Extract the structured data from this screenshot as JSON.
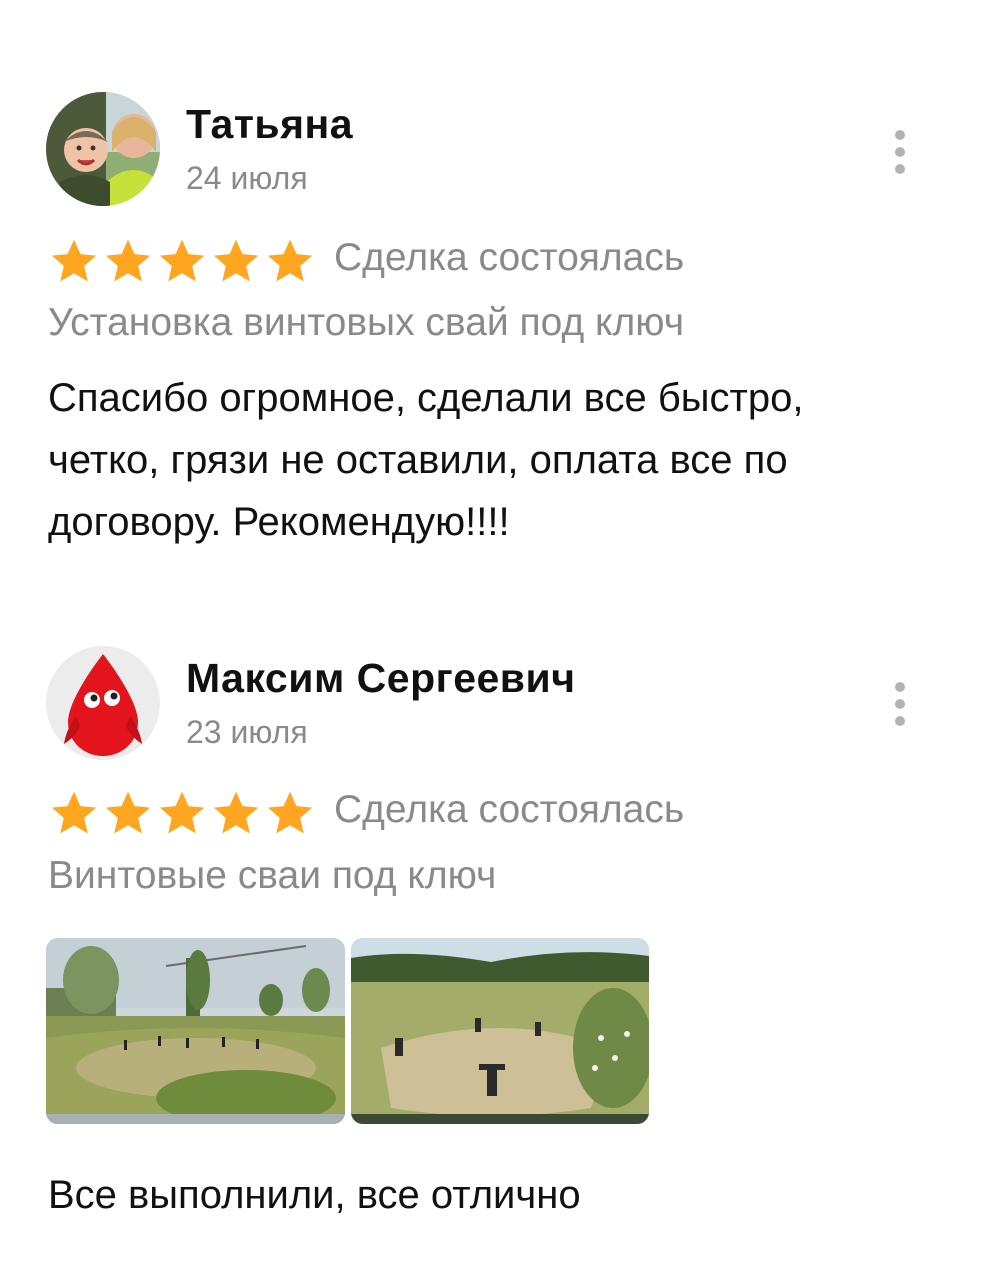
{
  "reviews": [
    {
      "author": "Татьяна",
      "date": "24 июля",
      "rating": 5,
      "status": "Сделка состоялась",
      "service": "Установка винтовых свай под ключ",
      "text_lines": [
        "Спасибо огромное, сделали все быстро,",
        "четко, грязи не оставили, оплата все по",
        "договору. Рекомендую!!!!"
      ],
      "avatar": "user-photo-avatar"
    },
    {
      "author": "Максим Сергеевич",
      "date": "23 июля",
      "rating": 5,
      "status": "Сделка состоялась",
      "service": "Винтовые сваи под ключ",
      "photos": [
        "field-with-piles-photo",
        "field-with-piles-photo"
      ],
      "text_lines": [
        "Все выполнили, все отлично"
      ],
      "avatar": "red-drop-mascot-avatar"
    }
  ],
  "colors": {
    "star": "#FFA51F",
    "secondary_text": "#8A8A8A",
    "menu_dots": "#B3B3B3"
  }
}
